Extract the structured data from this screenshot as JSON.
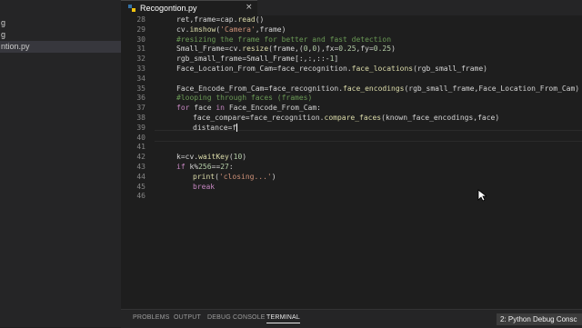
{
  "sidebar": {
    "items": [
      {
        "label": "g"
      },
      {
        "label": "g"
      },
      {
        "label": "ntion.py",
        "active": true
      }
    ]
  },
  "tab": {
    "label": "Recogontion.py",
    "close": "×"
  },
  "editor": {
    "current_line": 39,
    "lines": [
      {
        "n": "28",
        "text": "ret,frame=cap.read()"
      },
      {
        "n": "29",
        "text": "cv2.imshow('Camera',frame)"
      },
      {
        "n": "30",
        "text": "#resizing the frame for better and fast detection"
      },
      {
        "n": "31",
        "text": "Small_Frame=cv2.resize(frame,(0,0),fx=0.25,fy=0.25)"
      },
      {
        "n": "32",
        "text": "rgb_small_frame=Small_Frame[:,:,::-1]"
      },
      {
        "n": "33",
        "text": "Face_Location_From_Cam=face_recognition.face_locations(rgb_small_frame)"
      },
      {
        "n": "34",
        "text": ""
      },
      {
        "n": "35",
        "text": "Face_Encode_From_Cam=face_recognition.face_encodings(rgb_small_frame,Face_Location_From_Cam)"
      },
      {
        "n": "36",
        "text": "#looping through faces (frames)"
      },
      {
        "n": "37",
        "text": "for face in Face_Encode_From_Cam:"
      },
      {
        "n": "38",
        "text": "face_compare=face_recognition.compare_faces(known_face_encodings,face)"
      },
      {
        "n": "39",
        "text": "distance=f"
      },
      {
        "n": "40",
        "text": ""
      },
      {
        "n": "41",
        "text": ""
      },
      {
        "n": "42",
        "text": "k=cv2.waitKey(10)"
      },
      {
        "n": "43",
        "text": "if k%256==27:"
      },
      {
        "n": "44",
        "text": "print('closing...')"
      },
      {
        "n": "45",
        "text": "break"
      },
      {
        "n": "46",
        "text": ""
      }
    ]
  },
  "panel": {
    "tabs": [
      {
        "label": "PROBLEMS"
      },
      {
        "label": "OUTPUT"
      },
      {
        "label": "DEBUG CONSOLE"
      },
      {
        "label": "TERMINAL",
        "active": true
      }
    ],
    "terminal_select": "2: Python Debug Consc"
  },
  "colors": {
    "editor_bg": "#1e1e1e",
    "sidebar_bg": "#252526",
    "keyword": "#569cd6",
    "control_keyword": "#c586c0",
    "string": "#ce9178",
    "comment": "#6a9955",
    "function": "#dcdcaa",
    "number": "#b5cea8"
  }
}
